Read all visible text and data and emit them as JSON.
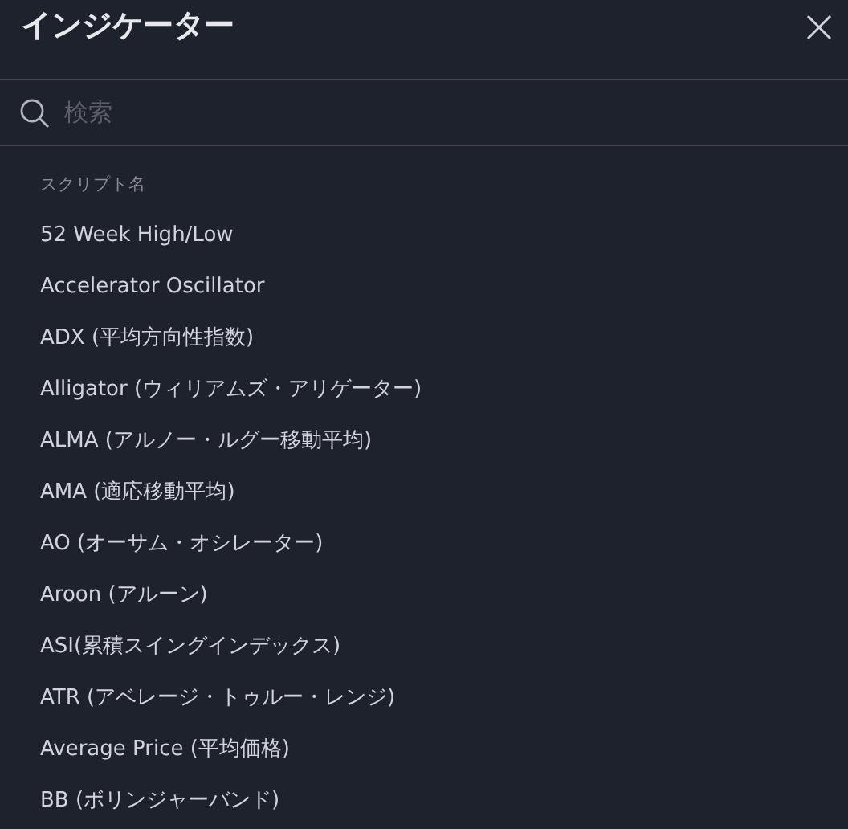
{
  "dialog": {
    "title": "インジケーター"
  },
  "search": {
    "placeholder": "検索"
  },
  "list": {
    "header": "スクリプト名",
    "items": [
      "52 Week High/Low",
      "Accelerator Oscillator",
      "ADX (平均方向性指数)",
      "Alligator (ウィリアムズ・アリゲーター)",
      "ALMA (アルノー・ルグー移動平均)",
      "AMA (適応移動平均)",
      "AO (オーサム・オシレーター)",
      "Aroon (アルーン)",
      "ASI(累積スイングインデックス)",
      "ATR (アベレージ・トゥルー・レンジ)",
      "Average Price (平均価格)",
      "BB (ボリンジャーバンド)"
    ]
  }
}
